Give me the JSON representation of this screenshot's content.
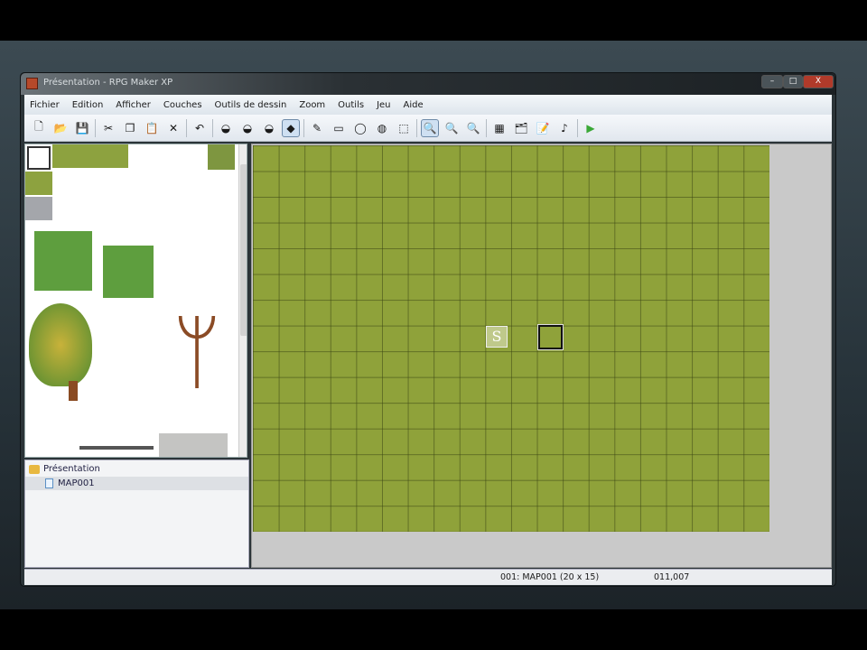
{
  "window": {
    "title": "Présentation - RPG Maker XP",
    "minimize": "–",
    "maximize": "□",
    "close": "X"
  },
  "menu": [
    "Fichier",
    "Edition",
    "Afficher",
    "Couches",
    "Outils de dessin",
    "Zoom",
    "Outils",
    "Jeu",
    "Aide"
  ],
  "toolbar": [
    {
      "icon": "new-icon",
      "g": "🗋"
    },
    {
      "icon": "open-icon",
      "g": "📂"
    },
    {
      "icon": "save-icon",
      "g": "💾"
    },
    {
      "sep": true
    },
    {
      "icon": "cut-icon",
      "g": "✂"
    },
    {
      "icon": "copy-icon",
      "g": "❐"
    },
    {
      "icon": "paste-icon",
      "g": "📋"
    },
    {
      "icon": "delete-icon",
      "g": "✕"
    },
    {
      "sep": true
    },
    {
      "icon": "undo-icon",
      "g": "↶"
    },
    {
      "sep": true
    },
    {
      "icon": "layer1-icon",
      "g": "◒"
    },
    {
      "icon": "layer2-icon",
      "g": "◒"
    },
    {
      "icon": "layer3-icon",
      "g": "◒"
    },
    {
      "icon": "events-layer-icon",
      "g": "◆",
      "on": true
    },
    {
      "sep": true
    },
    {
      "icon": "pencil-icon",
      "g": "✎"
    },
    {
      "icon": "rectangle-icon",
      "g": "▭"
    },
    {
      "icon": "ellipse-icon",
      "g": "◯"
    },
    {
      "icon": "fill-icon",
      "g": "◍"
    },
    {
      "icon": "select-icon",
      "g": "⬚"
    },
    {
      "sep": true
    },
    {
      "icon": "zoom-1-1-icon",
      "g": "🔍",
      "on": true
    },
    {
      "icon": "zoom-1-2-icon",
      "g": "🔍"
    },
    {
      "icon": "zoom-1-4-icon",
      "g": "🔍"
    },
    {
      "sep": true
    },
    {
      "icon": "database-icon",
      "g": "▦"
    },
    {
      "icon": "materialbase-icon",
      "g": "🗂"
    },
    {
      "icon": "script-editor-icon",
      "g": "📝"
    },
    {
      "icon": "sound-test-icon",
      "g": "♪"
    },
    {
      "sep": true
    },
    {
      "icon": "playtest-icon",
      "g": "▶"
    }
  ],
  "tree": {
    "project": "Présentation",
    "maps": [
      "MAP001"
    ]
  },
  "map": {
    "columns": 20,
    "rows": 15,
    "start_event": "S",
    "cursor": [
      11,
      7
    ]
  },
  "status": {
    "map": "001: MAP001 (20 x 15)",
    "coords": "011,007"
  }
}
